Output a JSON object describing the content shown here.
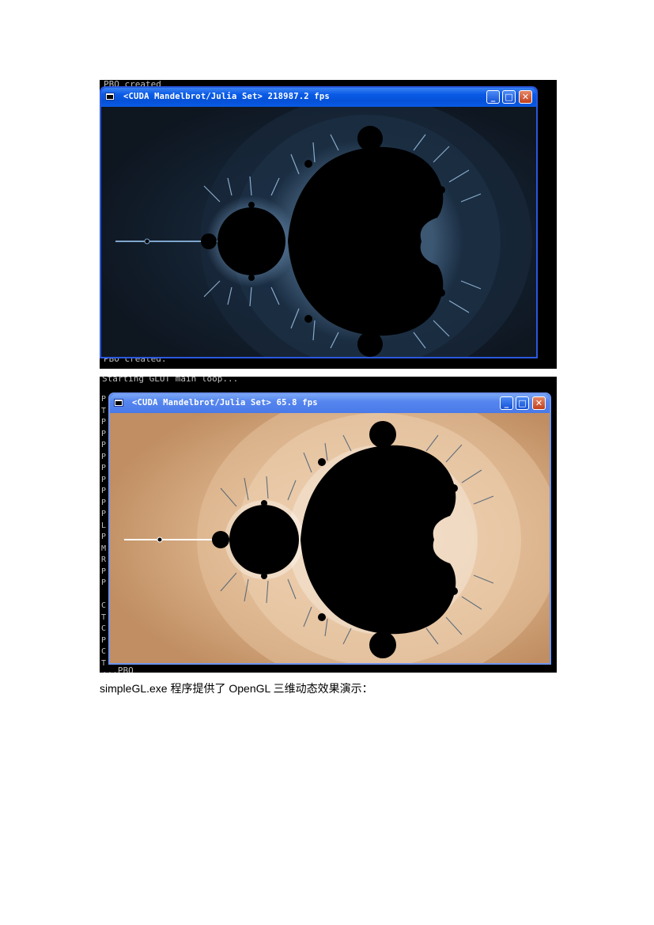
{
  "screenshot1": {
    "console_top": "PBO created",
    "console_bottom": "PBO created.",
    "window_title": "<CUDA Mandelbrot/Julia Set> 218987.2 fps"
  },
  "screenshot2": {
    "console_top": "Starting GLUT main loop...",
    "console_bottom": "...PBO",
    "left_chars": [
      "P",
      "T",
      "P",
      "P",
      "P",
      "P",
      "P",
      "P",
      "P",
      "P",
      "P",
      "L",
      "P",
      "M",
      "R",
      "P",
      "P",
      "",
      "C",
      "T",
      "C",
      "P",
      "C",
      "T"
    ],
    "window_title": "<CUDA Mandelbrot/Julia Set> 65.8 fps"
  },
  "window_buttons": {
    "minimize": "_",
    "maximize": "□",
    "close": "✕"
  },
  "caption": "simpleGL.exe 程序提供了 OpenGL 三维动态效果演示：",
  "colors": {
    "dark_bg": "#0e1620",
    "light_bg": "#c8996d",
    "fractal": "#000000",
    "window_frame": "#0831d9"
  }
}
